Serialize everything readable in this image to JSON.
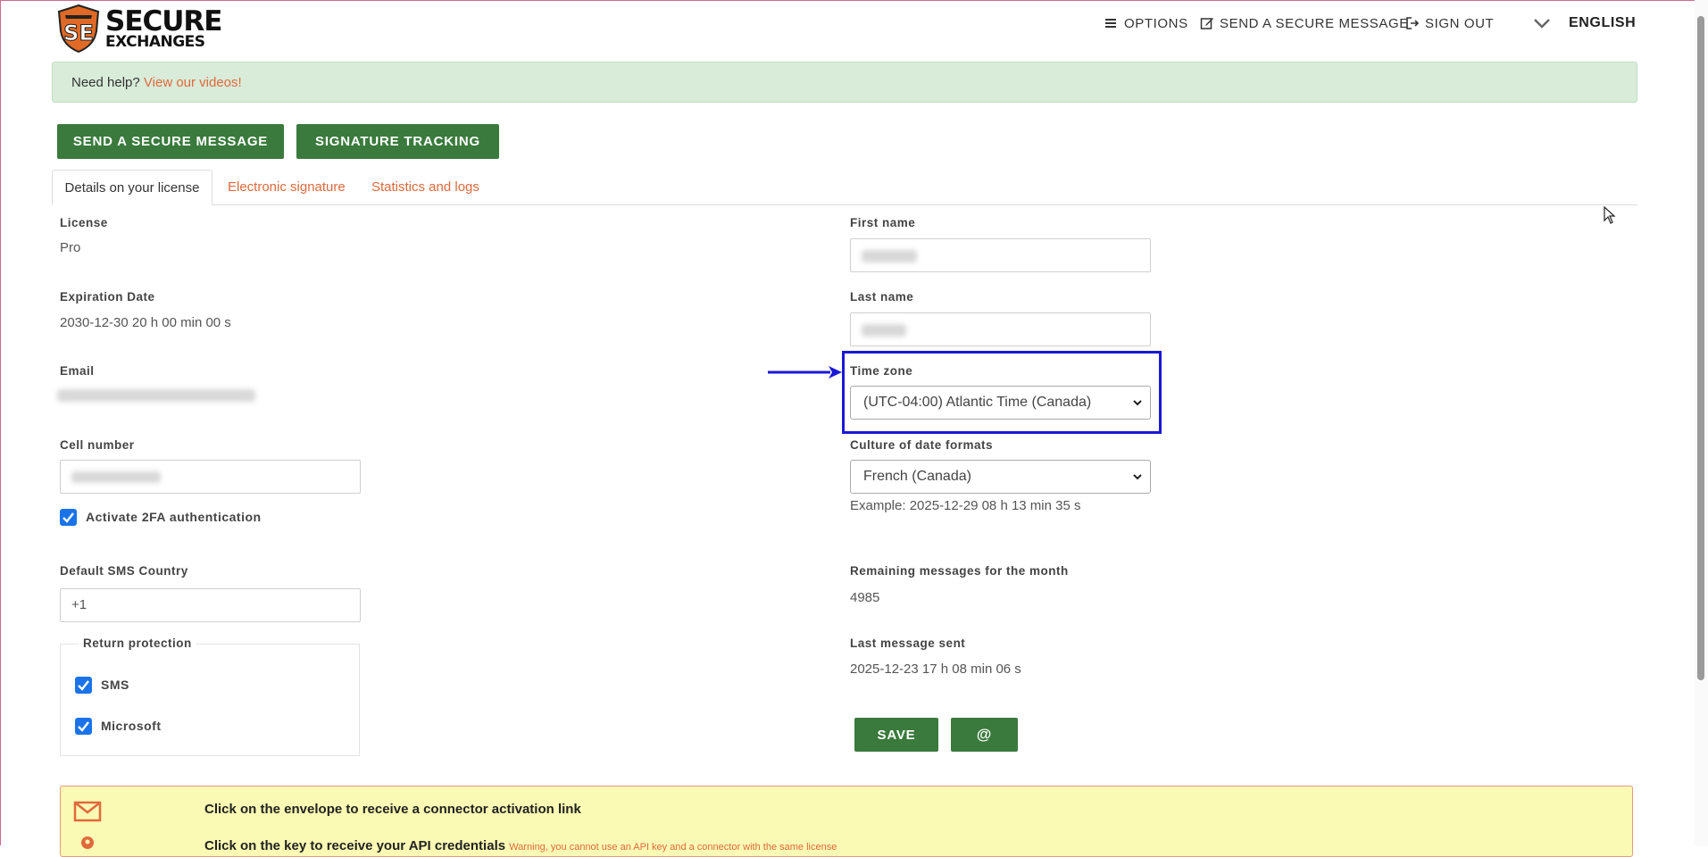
{
  "brand": {
    "line1": "SECURE",
    "line2": "EXCHANGES"
  },
  "topnav": {
    "options": "OPTIONS",
    "send": "SEND A SECURE MESSAGE",
    "signout": "SIGN OUT",
    "language": "ENGLISH"
  },
  "help": {
    "text": "Need help?",
    "link": "View our videos!"
  },
  "actions": {
    "send_label": "SEND A SECURE MESSAGE",
    "signature_label": "SIGNATURE TRACKING"
  },
  "tabs": [
    {
      "label": "Details on your license",
      "active": true
    },
    {
      "label": "Electronic signature",
      "active": false
    },
    {
      "label": "Statistics and logs",
      "active": false
    }
  ],
  "left": {
    "license_label": "License",
    "license_value": "Pro",
    "expiration_label": "Expiration Date",
    "expiration_value": "2030-12-30 20 h 00 min 00 s",
    "email_label": "Email",
    "cell_label": "Cell number",
    "twofa_label": "Activate 2FA authentication",
    "sms_country_label": "Default SMS Country",
    "sms_country_value": "+1",
    "return_protection_label": "Return protection",
    "rp_sms": "SMS",
    "rp_microsoft": "Microsoft"
  },
  "right": {
    "first_name_label": "First name",
    "last_name_label": "Last name",
    "timezone_label": "Time zone",
    "timezone_value": "(UTC-04:00) Atlantic Time (Canada)",
    "culture_label": "Culture of date formats",
    "culture_value": "French (Canada)",
    "culture_example": "Example: 2025-12-29 08 h 13 min 35 s",
    "remaining_label": "Remaining messages for the month",
    "remaining_value": "4985",
    "last_sent_label": "Last message sent",
    "last_sent_value": "2025-12-23 17 h 08 min 06 s",
    "save_label": "SAVE",
    "at_label": "@"
  },
  "connector": {
    "envelope_text": "Click on the envelope to receive a connector activation link",
    "key_text": "Click on the key to receive your API credentials",
    "key_warning": "Warning, you cannot use an API key and a connector with the same license"
  },
  "colors": {
    "accent_green": "#3a7a3c",
    "link_orange": "#e0693c",
    "highlight_blue": "#1a18d6",
    "checkbox_blue": "#1a73e8"
  }
}
